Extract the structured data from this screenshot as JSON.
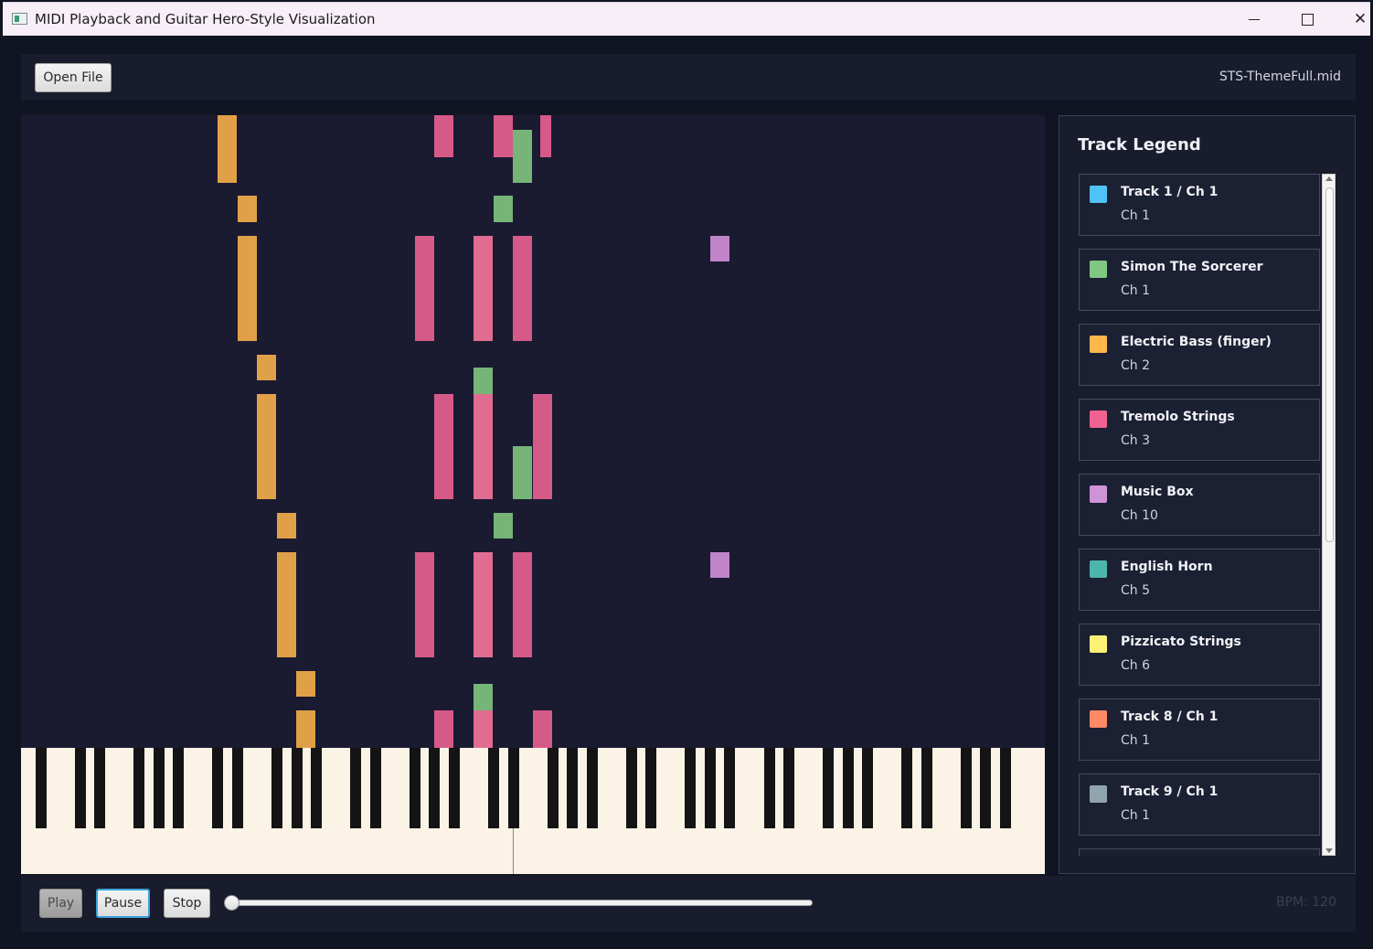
{
  "window": {
    "title": "MIDI Playback and Guitar Hero-Style Visualization",
    "minimize_glyph": "—",
    "close_glyph": "✕"
  },
  "toolbar": {
    "open_file_label": "Open File",
    "filename": "STS-ThemeFull.mid"
  },
  "legend": {
    "title": "Track Legend",
    "items": [
      {
        "name": "Track 1 / Ch 1",
        "channel": "Ch 1",
        "color": "#4fc3f7"
      },
      {
        "name": "Simon The Sorcerer",
        "channel": "Ch 1",
        "color": "#81c784"
      },
      {
        "name": "Electric Bass (finger)",
        "channel": "Ch 2",
        "color": "#ffb74d"
      },
      {
        "name": "Tremolo Strings",
        "channel": "Ch 3",
        "color": "#f06292"
      },
      {
        "name": "Music Box",
        "channel": "Ch 10",
        "color": "#ce93d8"
      },
      {
        "name": "English Horn",
        "channel": "Ch 5",
        "color": "#4db6ac"
      },
      {
        "name": "Pizzicato Strings",
        "channel": "Ch 6",
        "color": "#fff176"
      },
      {
        "name": "Track 8 / Ch 1",
        "channel": "Ch 1",
        "color": "#ff8a65"
      },
      {
        "name": "Track 9 / Ch 1",
        "channel": "Ch 1",
        "color": "#90a4ae"
      }
    ]
  },
  "transport": {
    "play_label": "Play",
    "pause_label": "Pause",
    "stop_label": "Stop",
    "progress_fraction": 0.0,
    "bpm_text": "BPM: 120"
  },
  "colors": {
    "bass_note": "#e0a048",
    "strings_note": "#d65a88",
    "strings_light": "#e06c92",
    "sorcerer_note": "#76b478",
    "musicbox_note": "#c084c8"
  }
}
